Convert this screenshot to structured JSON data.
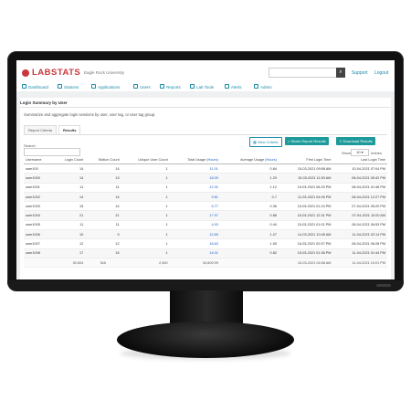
{
  "header": {
    "brand": "LABSTATS",
    "org": "Eagle Rock University",
    "support": "Support",
    "logout": "Logout"
  },
  "nav": [
    "Dashboard",
    "Stations",
    "Applications",
    "Users",
    "Reports",
    "Lab Tools",
    "Alerts",
    "Admin"
  ],
  "page": {
    "title": "Login Summary by User",
    "description": "Summarize and aggregate login sessions by user, user tag, or user tag group.",
    "tabs": [
      "Report Criteria",
      "Results"
    ],
    "buttons": {
      "view_criteria": "View Criteria",
      "share": "Share Report Results",
      "download": "Download Results"
    },
    "search_label": "Search",
    "show_label": "Show",
    "show_value": "10",
    "entries_label": "entries"
  },
  "table": {
    "columns": [
      "Username",
      "Login Count",
      "Station Count",
      "Unique User Count",
      "Total Usage",
      "(Hours)",
      "Average Usage",
      "(Hours)",
      "First Login Time",
      "Last Login Time"
    ],
    "rows": [
      [
        "user100",
        "14",
        "14",
        "1",
        "11.01",
        "0.84",
        "15-03-2021 09:58 AM",
        "10-04-2021 07:04 PM"
      ],
      [
        "user1000",
        "14",
        "13",
        "1",
        "18.09",
        "1.29",
        "15-03-2021 11:53 AM",
        "08-04-2021 05:42 PM"
      ],
      [
        "user1001",
        "11",
        "11",
        "1",
        "12.32",
        "1.12",
        "15-03-2021 06:25 PM",
        "08-04-2021 01:48 PM"
      ],
      [
        "user1002",
        "14",
        "14",
        "1",
        "9.81",
        "0.7",
        "11-03-2021 04:06 PM",
        "08-04-2021 12:27 PM"
      ],
      [
        "user1003",
        "15",
        "14",
        "1",
        "5.77",
        "0.36",
        "15-03-2021 01:24 PM",
        "07-04-2021 05:20 PM"
      ],
      [
        "user1004",
        "21",
        "21",
        "1",
        "17.97",
        "0.86",
        "15-03-2021 12:31 PM",
        "07-04-2021 10:00 AM"
      ],
      [
        "user1005",
        "11",
        "11",
        "1",
        "4.93",
        "0.44",
        "15-03-2021 01:01 PM",
        "08-04-2021 06:53 PM"
      ],
      [
        "user1006",
        "10",
        "9",
        "1",
        "12.69",
        "1.27",
        "14-03-2021 10:45 AM",
        "11-04-2021 02:14 PM"
      ],
      [
        "user1007",
        "12",
        "12",
        "1",
        "18.63",
        "1.55",
        "16-03-2021 02:57 PM",
        "08-04-2021 06:28 PM"
      ],
      [
        "user1008",
        "17",
        "16",
        "1",
        "14.01",
        "0.82",
        "15-03-2021 01:38 PM",
        "11-04-2021 01:44 PM"
      ]
    ],
    "footer": [
      "",
      "30,604",
      "N/A",
      "2,500",
      "34,609.99",
      "",
      "15-03-2021 04:58 AM",
      "11-04-2021 10:01 PM"
    ]
  }
}
